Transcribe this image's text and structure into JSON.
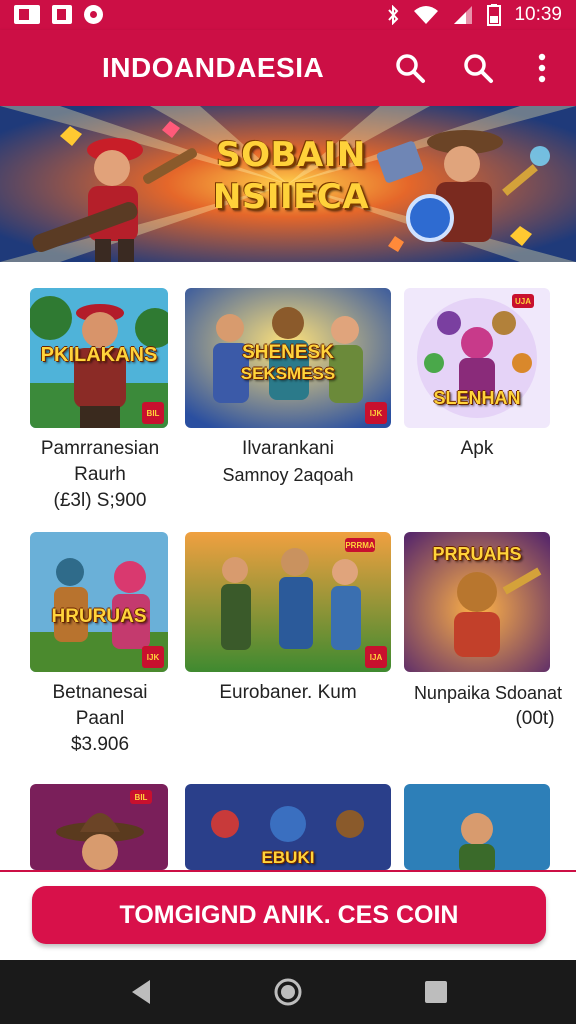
{
  "status_bar": {
    "time": "10:39",
    "icons": [
      "gallery-icon",
      "video-icon",
      "disc-icon",
      "bluetooth-icon",
      "wifi-icon",
      "signal-icon",
      "battery-icon"
    ]
  },
  "app_bar": {
    "title": "INDOANDAESIA",
    "actions": [
      "search-icon",
      "search-icon",
      "more-vert-icon"
    ]
  },
  "banner": {
    "title_line1": "SOBAIN",
    "title_line2": "NSIIECA"
  },
  "games": [
    {
      "art_title": "PKILAKANS",
      "name_line1": "Pamrranesian",
      "name_line2": "Raurh",
      "name_line3": "(£3l) S;900"
    },
    {
      "art_title": "SHENESK",
      "art_title2": "SEKSMESS",
      "name_line1": "Ilvarankani",
      "name_line2": "Samnoy 2aqoah"
    },
    {
      "art_title": "SLENHAN",
      "name_line1": "Apk"
    },
    {
      "art_title": "HRURUAS",
      "name_line1": "Betnanesai",
      "name_line2": "Paanl",
      "name_line3": "$3.906"
    },
    {
      "art_title": "PRRMA",
      "name_line1": "Eurobaner. Kum"
    },
    {
      "art_title": "PRRUAHS",
      "name_line1": "Nunpaika Sdoanat",
      "name_line2": "(00t)"
    },
    {
      "art_title": "",
      "name_line1": ""
    },
    {
      "art_title": "EBUKI",
      "name_line1": ""
    },
    {
      "art_title": "",
      "name_line1": ""
    }
  ],
  "cta": {
    "label": "TOMGIGND ANIK. CES COIN"
  },
  "colors": {
    "brand": "#cc0f45",
    "cta": "#d8114a",
    "navbar": "#1a1a1a"
  },
  "nav_bar": {
    "buttons": [
      "back-icon",
      "home-icon",
      "recents-icon"
    ]
  }
}
